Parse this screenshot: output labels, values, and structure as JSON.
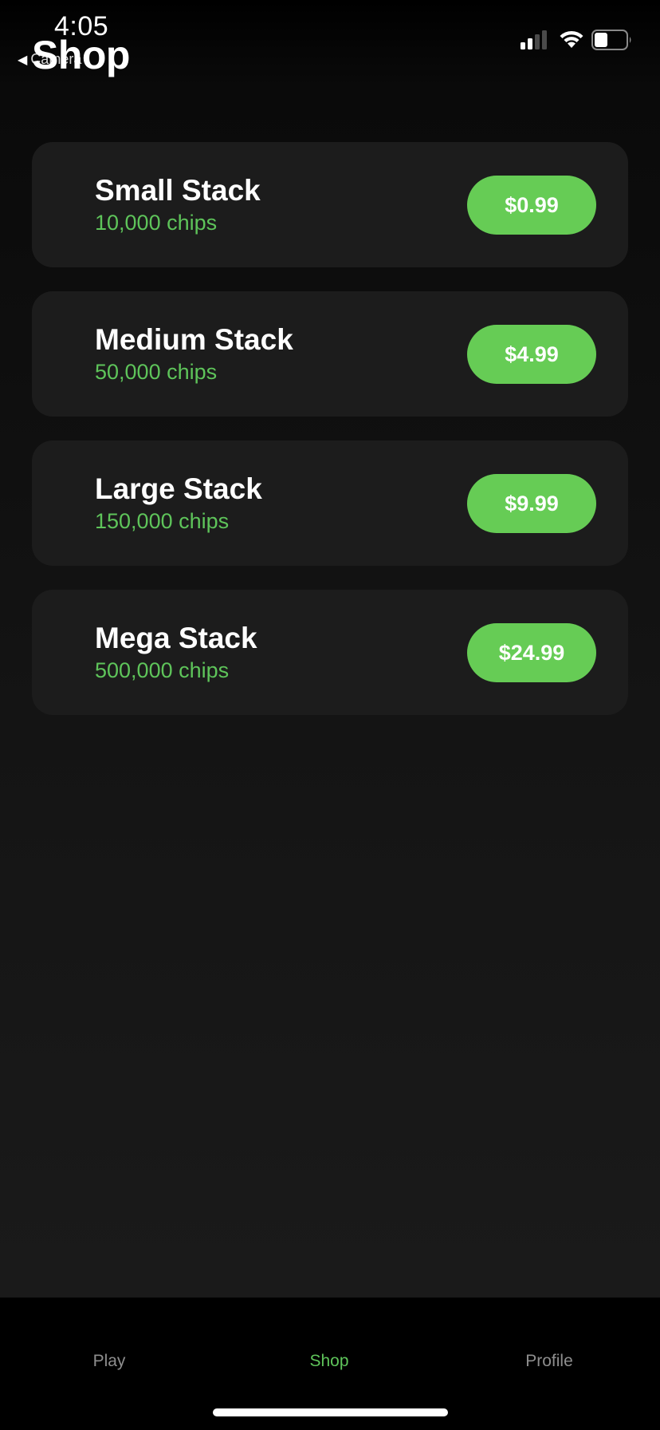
{
  "status_bar": {
    "time": "4:05",
    "back_app": "Camera"
  },
  "nav": {
    "title": "Shop"
  },
  "packages": [
    {
      "name": "Small Stack",
      "chips": "10,000 chips",
      "price": "$0.99"
    },
    {
      "name": "Medium Stack",
      "chips": "50,000 chips",
      "price": "$4.99"
    },
    {
      "name": "Large Stack",
      "chips": "150,000 chips",
      "price": "$9.99"
    },
    {
      "name": "Mega Stack",
      "chips": "500,000 chips",
      "price": "$24.99"
    }
  ],
  "tabs": [
    {
      "label": "Play"
    },
    {
      "label": "Shop"
    },
    {
      "label": "Profile"
    }
  ],
  "active_tab": "Shop",
  "colors": {
    "accent": "#66cc55",
    "chips_text": "#5ec45a",
    "card_bg": "#1c1c1c"
  },
  "icons": {
    "signal": "cellular-signal-icon",
    "wifi": "wifi-icon",
    "battery": "battery-icon",
    "back": "back-triangle-icon"
  }
}
